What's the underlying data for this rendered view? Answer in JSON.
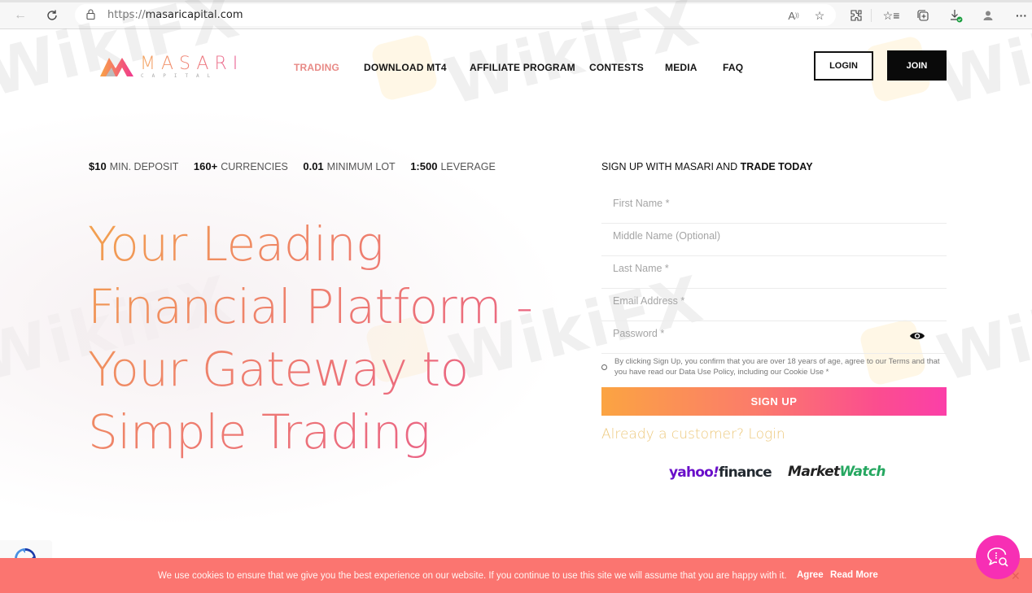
{
  "browser": {
    "url_protocol": "https://",
    "url_host": "masaricapital.com",
    "icons": [
      "back-icon",
      "refresh-icon",
      "lock-icon",
      "read-aloud-icon",
      "add-favorite-icon",
      "extensions-icon",
      "favorites-icon",
      "collections-icon",
      "downloads-icon",
      "profile-icon",
      "more-icon"
    ]
  },
  "header": {
    "logo_text": "MASARI",
    "logo_subtext": "CAPITAL",
    "nav": [
      {
        "label": "TRADING",
        "active": true
      },
      {
        "label": "DOWNLOAD MT4",
        "active": false
      },
      {
        "label": "AFFILIATE PROGRAM",
        "active": false
      },
      {
        "label": "CONTESTS",
        "active": false
      },
      {
        "label": "MEDIA",
        "active": false
      },
      {
        "label": "FAQ",
        "active": false
      }
    ],
    "login_label": "LOGIN",
    "join_label": "JOIN"
  },
  "hero": {
    "stats": [
      {
        "value": "$10",
        "label": "MIN. DEPOSIT"
      },
      {
        "value": "160+",
        "label": "CURRENCIES"
      },
      {
        "value": "0.01",
        "label": "MINIMUM LOT"
      },
      {
        "value": "1:500",
        "label": "LEVERAGE"
      }
    ],
    "headline_lines": [
      "Your Leading",
      "Financial Platform -",
      "Your Gateway to",
      "Simple Trading"
    ]
  },
  "signup": {
    "title_normal": "SIGN UP WITH MASARI AND ",
    "title_bold": "TRADE TODAY",
    "fields": [
      {
        "placeholder": "First Name *",
        "value": ""
      },
      {
        "placeholder": "Middle Name (Optional)",
        "value": ""
      },
      {
        "placeholder": "Last Name *",
        "value": ""
      },
      {
        "placeholder": "Email Address *",
        "value": ""
      },
      {
        "placeholder": "Password *",
        "value": ""
      }
    ],
    "consent_text": "By clicking Sign Up, you confirm that you are over 18 years of age, agree to our Terms and that you have read our Data Use Policy, including our Cookie Use *",
    "consent_checked": false,
    "submit_label": "SIGN UP",
    "already_customer_label": "Already a customer? Login",
    "press_logos": {
      "yahoo_part1": "yahoo",
      "yahoo_bang": "!",
      "yahoo_part2": "finance",
      "mw_part1": "Market",
      "mw_part2": "Watch"
    }
  },
  "cookie_bar": {
    "message": "We use cookies to ensure that we give you the best experience on our website. If you continue to use this site we will assume that you are happy with it.",
    "agree_label": "Agree",
    "read_more_label": "Read More",
    "close_glyph": "✕"
  },
  "watermark": "WikiFX",
  "colors": {
    "accent_pink": "#f72fb4",
    "cookie_bg": "#fb7570",
    "nav_active": "#e88a86",
    "login_link": "#edc97d"
  }
}
